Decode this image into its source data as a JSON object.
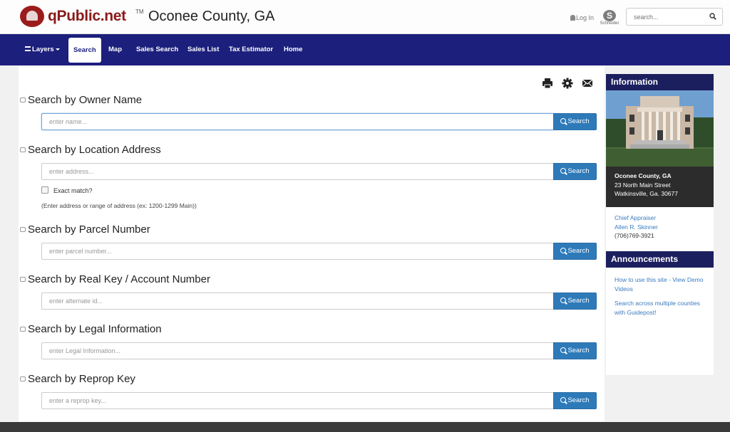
{
  "header": {
    "logo_text": "qPublic.net",
    "logo_tm": "TM",
    "county": "Oconee County, GA",
    "login": "Log In",
    "partner": "Schneider",
    "search_placeholder": "search..."
  },
  "nav": {
    "items": [
      {
        "label": "Layers"
      },
      {
        "label": "Search"
      },
      {
        "label": "Map"
      },
      {
        "label": "Sales Search"
      },
      {
        "label": "Sales List"
      },
      {
        "label": "Tax Estimator"
      },
      {
        "label": "Home"
      }
    ]
  },
  "sections": [
    {
      "title": "Search by Owner Name",
      "placeholder": "enter name...",
      "button": "Search"
    },
    {
      "title": "Search by Location Address",
      "placeholder": "enter address...",
      "button": "Search"
    },
    {
      "title": "Search by Parcel Number",
      "placeholder": "enter parcel number...",
      "button": "Search"
    },
    {
      "title": "Search by Real Key / Account Number",
      "placeholder": "enter alternate id...",
      "button": "Search"
    },
    {
      "title": "Search by Legal Information",
      "placeholder": "enter Legal Information...",
      "button": "Search"
    },
    {
      "title": "Search by Reprop Key",
      "placeholder": "enter a reprop key...",
      "button": "Search"
    }
  ],
  "address_options": {
    "exact_match_label": "Exact match?",
    "hint": "(Enter address or range of address (ex: 1200-1299 Main))"
  },
  "sidebar": {
    "info_title": "Information",
    "office_name": "Oconee County, GA",
    "office_street": "23 North Main Street",
    "office_city": "Watkinsville, Ga. 30677",
    "appraiser_title": "Chief Appraiser",
    "appraiser_name": "Allen R. Skinner",
    "phone": "(706)769-3921",
    "announcements_title": "Announcements",
    "announcement_1": "How to use this site - View Demo Videos",
    "announcement_2": "Search across multiple counties with Guidepost!"
  },
  "colors": {
    "nav_bg": "#1c1f7c",
    "button": "#2e7ab9",
    "sidebar_head": "#1c1f5e"
  }
}
